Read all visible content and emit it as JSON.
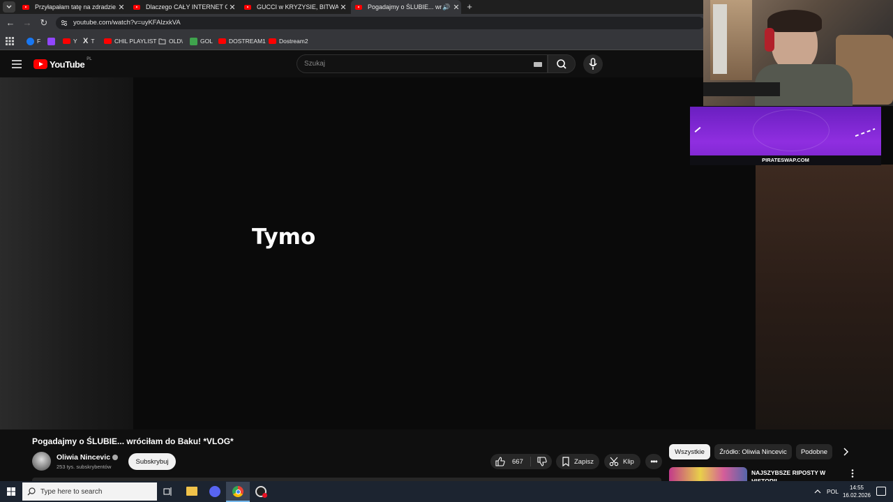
{
  "browser": {
    "tabs": [
      {
        "title": "Przyłapałam tatę na zdradzie. -",
        "active": false
      },
      {
        "title": "Dlaczego CAŁY INTERNET Obs",
        "active": false
      },
      {
        "title": "GUCCI w KRYZYSIE, BITWA o TA",
        "active": false
      },
      {
        "title": "Pogadajmy o ŚLUBIE... wróc",
        "active": true
      }
    ],
    "url": "youtube.com/watch?v=uyKFAlzxkVA",
    "bookmarks": [
      {
        "label": "F",
        "icon": "facebook-icon",
        "color": "#1877f2"
      },
      {
        "label": "",
        "icon": "twitch-icon",
        "color": "#9146ff"
      },
      {
        "label": "Y",
        "icon": "youtube-icon",
        "color": "#ff0000"
      },
      {
        "label": "T",
        "icon": "x-icon",
        "color": "#ffffff"
      },
      {
        "label": "CHIL PLAYLIST",
        "icon": "youtube-icon",
        "color": "#ff0000"
      },
      {
        "label": "OLD\\",
        "icon": "folder-icon",
        "color": "#cfcfcf"
      },
      {
        "label": "GOL",
        "icon": "g-icon",
        "color": "#3fa34d"
      },
      {
        "label": "DOSTREAM1",
        "icon": "youtube-icon",
        "color": "#ff0000"
      },
      {
        "label": "Dostream2",
        "icon": "youtube-icon",
        "color": "#ff0000"
      }
    ]
  },
  "youtube": {
    "logo_text": "YouTube",
    "region": "PL",
    "search_placeholder": "Szukaj"
  },
  "video": {
    "overlay_text": "Tymo",
    "title": "Pogadajmy o ŚLUBIE... wróciłam do Baku! *VLOG*",
    "channel_name": "Oliwia Nincevic",
    "subscribers": "253 tys. subskrybentów",
    "subscribe_label": "Subskrybuj",
    "likes": "667",
    "save_label": "Zapisz",
    "clip_label": "Klip"
  },
  "overlay": {
    "ad_text": "PIRATESWAP.COM"
  },
  "recommendations": {
    "chips": [
      "Wszystkie",
      "Źródło: Oliwia Nincevic",
      "Podobne"
    ],
    "first_title": "NAJSZYBSZE RIPOSTY W HISTORII"
  },
  "taskbar": {
    "search_placeholder": "Type here to search",
    "language": "POL",
    "time": "14:55",
    "date": "16.02.2026"
  },
  "colors": {
    "youtube_red": "#ff0000",
    "background": "#0f0f0f",
    "ad_purple": "#8f2ee0"
  }
}
